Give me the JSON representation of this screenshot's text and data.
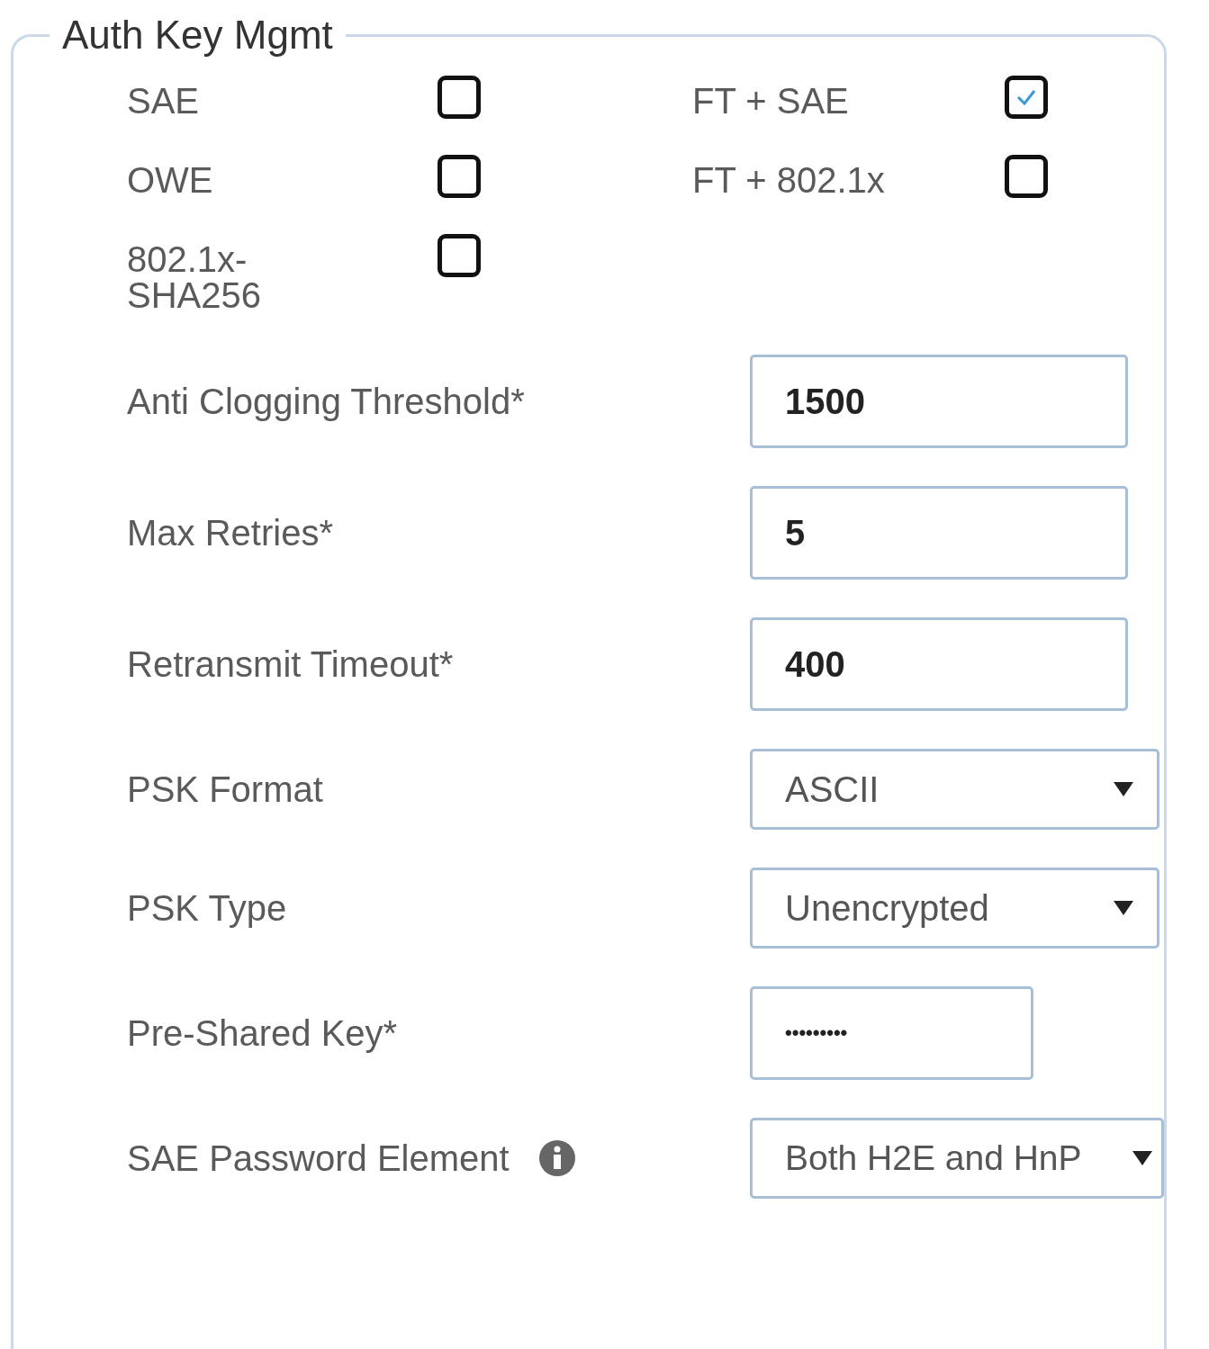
{
  "section": {
    "title": "Auth Key Mgmt"
  },
  "key_mgmt": [
    {
      "label": "SAE",
      "checked": false
    },
    {
      "label": "FT + SAE",
      "checked": true
    },
    {
      "label": "OWE",
      "checked": false
    },
    {
      "label": "FT + 802.1x",
      "checked": false
    },
    {
      "label": "802.1x-SHA256",
      "checked": false
    }
  ],
  "fields": [
    {
      "kind": "input",
      "label": "Anti Clogging Threshold*",
      "value": "1500"
    },
    {
      "kind": "input",
      "label": "Max Retries*",
      "value": "5"
    },
    {
      "kind": "input",
      "label": "Retransmit Timeout*",
      "value": "400"
    },
    {
      "kind": "select",
      "label": "PSK Format",
      "value": "ASCII"
    },
    {
      "kind": "select",
      "label": "PSK Type",
      "value": "Unencrypted"
    },
    {
      "kind": "password",
      "label": "Pre-Shared Key*",
      "value": "•••••••••"
    },
    {
      "kind": "select",
      "label": "SAE Password Element",
      "value": "Both H2E and HnP",
      "info": true
    }
  ]
}
